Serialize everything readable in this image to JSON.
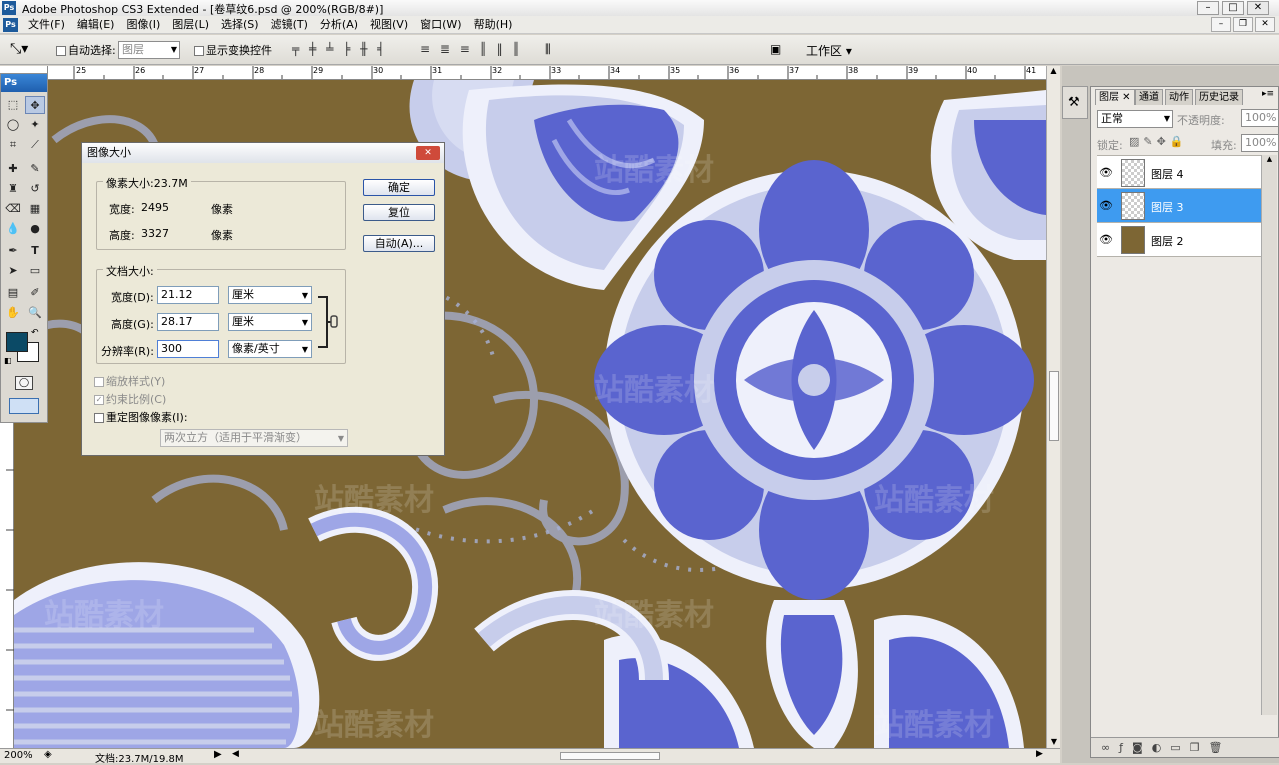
{
  "window": {
    "title": "Adobe Photoshop CS3 Extended - [卷草纹6.psd @ 200%(RGB/8#)]",
    "app_badge": "Ps"
  },
  "menu": [
    "文件(F)",
    "编辑(E)",
    "图像(I)",
    "图层(L)",
    "选择(S)",
    "滤镜(T)",
    "分析(A)",
    "视图(V)",
    "窗口(W)",
    "帮助(H)"
  ],
  "options": {
    "auto_select": "自动选择:",
    "layer_option": "图层",
    "show_transform": "显示变换控件",
    "workspace": "工作区"
  },
  "ruler": {
    "marks": [
      "25",
      "26",
      "27",
      "28",
      "29",
      "30",
      "31",
      "32",
      "33",
      "34",
      "35",
      "36",
      "37",
      "38",
      "39",
      "40",
      "41"
    ]
  },
  "toolbox": {
    "label": "Ps",
    "foreground_color": "#0b4a66",
    "background_color": "#ffffff"
  },
  "status": {
    "zoom": "200%",
    "doc_info": "文档:23.7M/19.8M"
  },
  "dialog": {
    "title": "图像大小",
    "pixel_dims": "像素大小:23.7M",
    "width_label": "宽度:",
    "width_value": "2495",
    "width_unit": "像素",
    "height_label": "高度:",
    "height_value": "3327",
    "height_unit": "像素",
    "doc_size": "文档大小:",
    "doc_width_label": "宽度(D):",
    "doc_width_value": "21.12",
    "doc_width_unit": "厘米",
    "doc_height_label": "高度(G):",
    "doc_height_value": "28.17",
    "doc_height_unit": "厘米",
    "resolution_label": "分辨率(R):",
    "resolution_value": "300",
    "resolution_unit": "像素/英寸",
    "scale_styles": "缩放样式(Y)",
    "constrain": "约束比例(C)",
    "resample": "重定图像像素(I):",
    "resample_method": "两次立方（适用于平滑渐变）",
    "ok": "确定",
    "reset": "复位",
    "auto": "自动(A)..."
  },
  "layers_panel": {
    "tabs": [
      "图层",
      "通道",
      "动作",
      "历史记录"
    ],
    "blend_mode": "正常",
    "opacity_label": "不透明度:",
    "opacity": "100%",
    "lock_label": "锁定:",
    "fill_label": "填充:",
    "fill": "100%",
    "layers": [
      {
        "name": "图层 4"
      },
      {
        "name": "图层 3"
      },
      {
        "name": "图层 2"
      }
    ],
    "layer2_color": "#7d6634",
    "selected_color": "#3e9bf0"
  }
}
